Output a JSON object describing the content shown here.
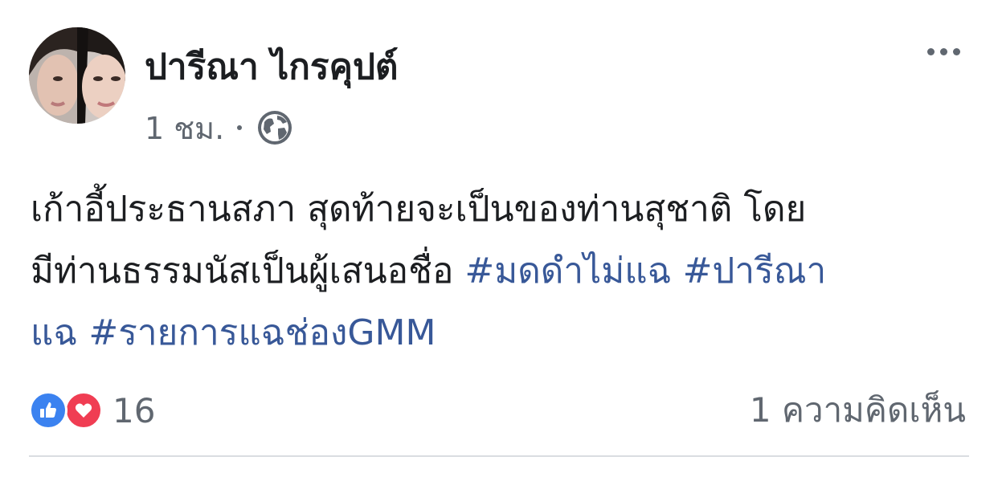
{
  "post": {
    "author": "ปารีณา ไกรคุปต์",
    "time": "1 ชม.",
    "privacy_icon": "globe-icon",
    "more_icon": "more-dots-icon",
    "text_lines": [
      [
        "เก้าอี้ประธานสภา สุดท้ายจะเป็นของท่านสุชาติ โดย"
      ],
      [
        "มีท่านธรรมนัสเป็นผู้เสนอชื่อ ",
        "#มดดำไม่แฉ",
        " ",
        "#ปารีณา"
      ],
      [
        "แฉ",
        " ",
        "#รายการแฉช่องGMM"
      ]
    ],
    "reactions": {
      "icons": [
        "like-icon",
        "love-icon"
      ],
      "count": "16"
    },
    "comments_label": "1 ความคิดเห็น"
  },
  "colors": {
    "text": "#1c1e21",
    "secondary": "#606770",
    "hashtag": "#385898",
    "like": "#3b82f0",
    "love": "#f03d53",
    "divider": "#dadde1"
  }
}
